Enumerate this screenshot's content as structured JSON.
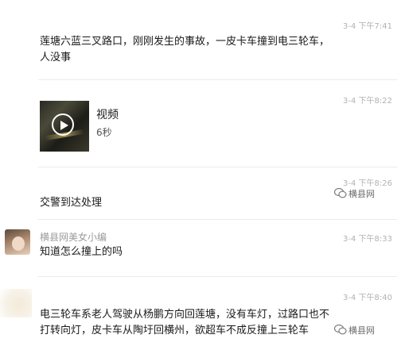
{
  "messages": [
    {
      "time": "3-4 下午7:41",
      "text_line1": "莲塘六蓝三叉路口，刚刚发生的事故，一皮卡车撞到电三轮车，",
      "text_line2": "人没事"
    },
    {
      "time": "3-4 下午8:22",
      "video_label": "视频",
      "video_duration": "6秒"
    },
    {
      "time": "3-4 下午8:26",
      "text": "交警到达处理"
    },
    {
      "time": "3-4 下午8:33",
      "sender": "横县网美女小编",
      "text": "知道怎么撞上的吗"
    },
    {
      "time": "3-4 下午8:40",
      "text_line1": "电三轮车系老人驾驶从杨鹏方向回莲塘，没有车灯，过路口也不",
      "text_line2": "打转向灯，皮卡车从陶圩回横州，欲超车不成反撞上三轮车"
    }
  ],
  "watermark": {
    "text": "横县网",
    "icon": "wechat-logo-icon"
  }
}
